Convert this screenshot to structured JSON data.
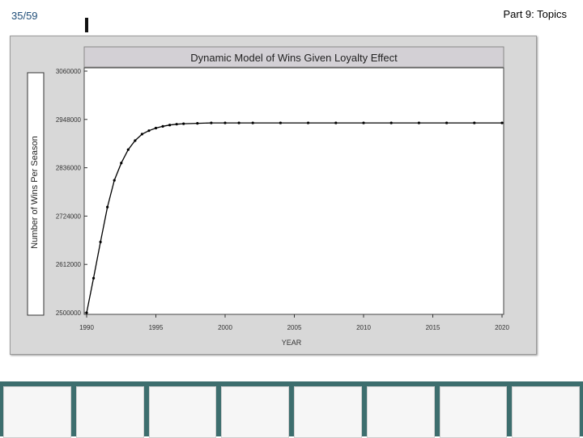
{
  "slide": {
    "number": "35/59",
    "topic": "Part 9: Topics"
  },
  "chart_data": {
    "type": "line",
    "title": "Dynamic Model of Wins Given Loyalty Effect",
    "xlabel": "YEAR",
    "ylabel": "Number of Wins Per Season",
    "xlim": [
      1990,
      2020
    ],
    "ylim": [
      2500000,
      3060000
    ],
    "x_ticks": [
      "1990",
      "1995",
      "2000",
      "2005",
      "2010",
      "2015",
      "2020"
    ],
    "y_ticks": [
      "2500000",
      "2612000",
      "2724000",
      "2836000",
      "2948000",
      "3060000"
    ],
    "grid": false,
    "series": [
      {
        "x": [
          1990,
          1990.5,
          1991,
          1991.5,
          1992,
          1992.5,
          1993,
          1993.5,
          1994,
          1994.5,
          1995,
          1995.5,
          1996,
          1996.5,
          1997,
          1998,
          1999,
          2000,
          2001,
          2002,
          2004,
          2006,
          2008,
          2010,
          2012,
          2014,
          2016,
          2018,
          2020
        ],
        "y": [
          2500000,
          2580000,
          2664000,
          2745000,
          2807000,
          2847000,
          2878000,
          2899000,
          2914000,
          2922000,
          2928000,
          2932000,
          2935000,
          2937000,
          2938000,
          2939000,
          2940000,
          2940000,
          2940000,
          2940000,
          2940000,
          2940000,
          2940000,
          2940000,
          2940000,
          2940000,
          2940000,
          2940000,
          2940000
        ],
        "color": "#000000"
      }
    ]
  },
  "thumbnails": [
    {
      "icon": "pie-chart-thumbnail-icon"
    },
    {
      "icon": "boxplot-thumbnail-icon"
    },
    {
      "icon": "scatter-thumbnail-icon"
    },
    {
      "icon": "probability-plot-thumbnail-icon"
    },
    {
      "icon": "scatter-fit-thumbnail-icon"
    },
    {
      "icon": "histogram-thumbnail-icon"
    },
    {
      "icon": "logistic-curve-thumbnail-icon"
    },
    {
      "icon": "scatter-histogram-thumbnail-icon"
    }
  ]
}
